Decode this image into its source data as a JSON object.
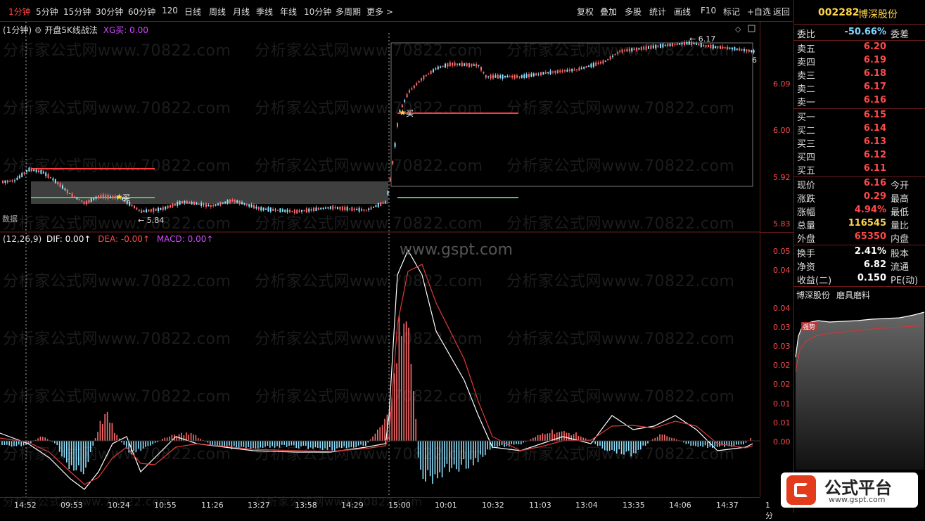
{
  "periods": [
    "1分钟",
    "5分钟",
    "15分钟",
    "30分钟",
    "60分钟",
    "120",
    "日线",
    "周线",
    "月线",
    "季线",
    "年线",
    "10分钟",
    "多周期",
    "更多 >"
  ],
  "active_period": "1分钟",
  "tools": [
    "复权",
    "叠加",
    "多股",
    "统计",
    "画线",
    "F10",
    "标记",
    "+自选",
    "返回"
  ],
  "main_chart": {
    "period_label": "(1分钟)",
    "indicator_name": "开盘5K线战法",
    "indicator_value": "XG买: 0.00",
    "price_ticks": [
      "6.09",
      "6.00",
      "5.92",
      "5.83"
    ],
    "high_label": "6.17",
    "low_label": "5.84",
    "buy_label": "买",
    "side_label": "数据",
    "right_edge_label": "6"
  },
  "macd": {
    "params": "(12,26,9)",
    "dif": "DIF: 0.00↑",
    "dea": "DEA: -0.00↑",
    "macd": "MACD: 0.00↑",
    "ticks": [
      "0.05",
      "0.04",
      "0.04",
      "0.03",
      "0.03",
      "0.02",
      "0.02",
      "0.01",
      "0.01",
      "0.00"
    ],
    "zero_label": "0.00",
    "gspt_watermark": "www.gspt.com"
  },
  "time_labels": [
    "14:52",
    "09:53",
    "10:24",
    "10:55",
    "11:26",
    "13:27",
    "13:58",
    "14:29",
    "15:00",
    "10:01",
    "10:32",
    "11:03",
    "13:04",
    "13:35",
    "14:06",
    "14:37"
  ],
  "time_unit": "1分",
  "stock": {
    "code": "002282",
    "name": "博深股份"
  },
  "weibi": {
    "label": "委比",
    "value": "-50.66%",
    "label2": "委差"
  },
  "asks": [
    {
      "label": "卖五",
      "price": "6.20"
    },
    {
      "label": "卖四",
      "price": "6.19"
    },
    {
      "label": "卖三",
      "price": "6.18"
    },
    {
      "label": "卖二",
      "price": "6.17"
    },
    {
      "label": "卖一",
      "price": "6.16"
    }
  ],
  "bids": [
    {
      "label": "买一",
      "price": "6.15"
    },
    {
      "label": "买二",
      "price": "6.14"
    },
    {
      "label": "买三",
      "price": "6.13"
    },
    {
      "label": "买四",
      "price": "6.12"
    },
    {
      "label": "买五",
      "price": "6.11"
    }
  ],
  "quote": [
    {
      "label": "现价",
      "value": "6.16",
      "label2": "今开",
      "color": "red"
    },
    {
      "label": "涨跌",
      "value": "0.29",
      "label2": "最高",
      "color": "red"
    },
    {
      "label": "涨幅",
      "value": "4.94%",
      "label2": "最低",
      "color": "red"
    },
    {
      "label": "总量",
      "value": "116545",
      "label2": "量比",
      "color": "yellow"
    },
    {
      "label": "外盘",
      "value": "65350",
      "label2": "内盘",
      "color": "red"
    },
    {
      "label": "换手",
      "value": "2.41%",
      "label2": "股本",
      "color": "white"
    },
    {
      "label": "净资",
      "value": "6.82",
      "label2": "流通",
      "color": "white"
    },
    {
      "label": "收益(二)",
      "value": "0.150",
      "label2": "PE(动)",
      "color": "white"
    }
  ],
  "mini_chart": {
    "tab1": "博深股份",
    "tab2": "磨具磨料",
    "badge": "强势"
  },
  "watermark": "分析家公式网www.70822.com",
  "logo_text": "公式平台",
  "logo_url": "www.gspt.com",
  "colors": {
    "up": "#ff4a4a",
    "down": "#7fd4ff",
    "accent": "#ffd54a"
  }
}
